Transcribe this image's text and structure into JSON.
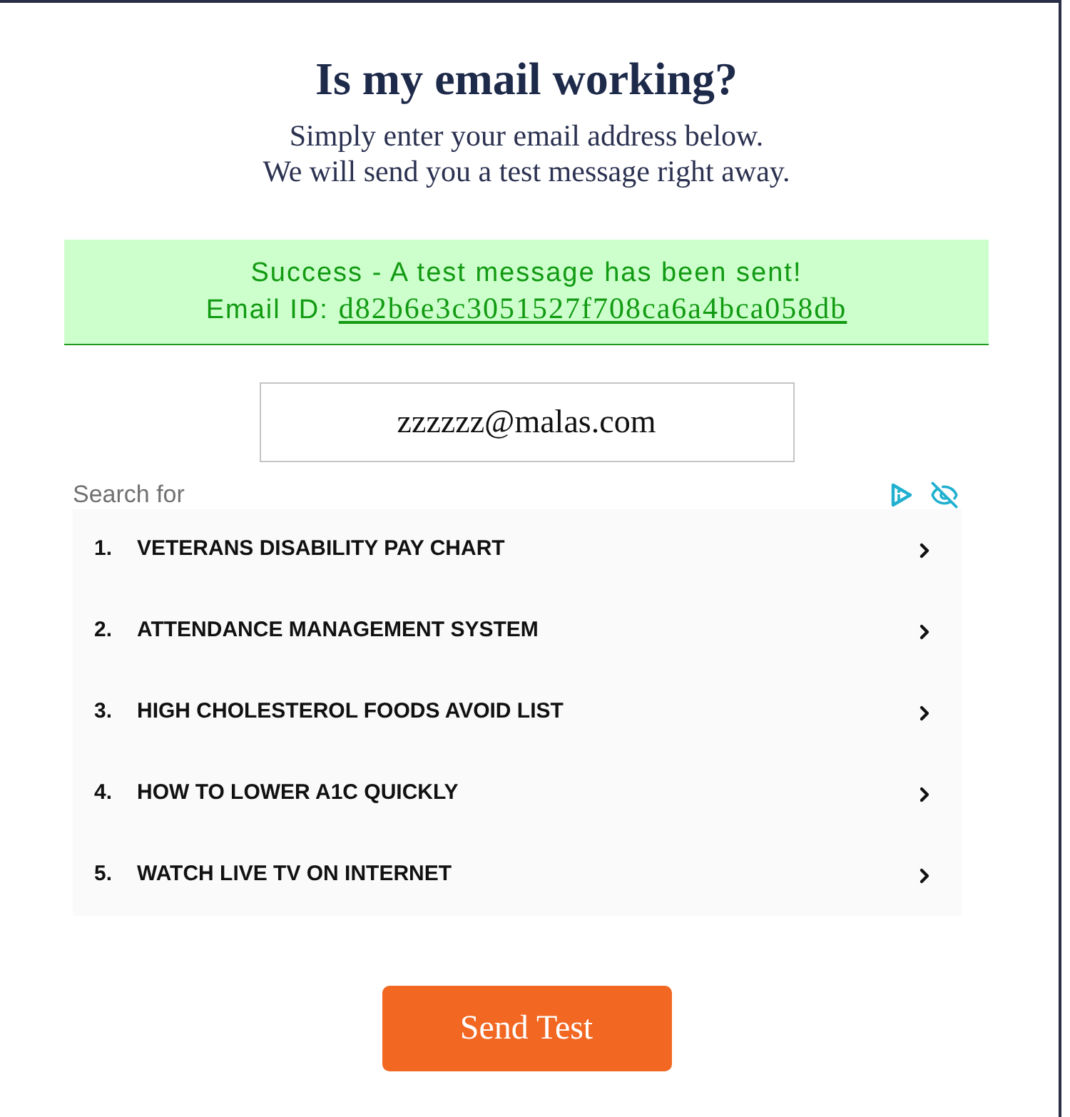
{
  "heading": {
    "title": "Is my email working?",
    "subtitle_lines": [
      "Simply enter your email address below.",
      "We will send you a test message right away."
    ]
  },
  "alert": {
    "kind": "success",
    "message": "Success - A test message has been sent!",
    "id_label": "Email ID:",
    "id_link": "d82b6e3c3051527f708ca6a4bca058db"
  },
  "email_field": {
    "value": "zzzzzz@malas.com"
  },
  "search_ads": {
    "label": "Search for",
    "items": [
      {
        "number": "1.",
        "text": "VETERANS DISABILITY PAY CHART"
      },
      {
        "number": "2.",
        "text": "ATTENDANCE MANAGEMENT SYSTEM"
      },
      {
        "number": "3.",
        "text": "HIGH CHOLESTEROL FOODS AVOID LIST"
      },
      {
        "number": "4.",
        "text": "HOW TO LOWER A1C QUICKLY"
      },
      {
        "number": "5.",
        "text": "WATCH LIVE TV ON INTERNET"
      }
    ]
  },
  "button": {
    "label": "Send Test"
  }
}
